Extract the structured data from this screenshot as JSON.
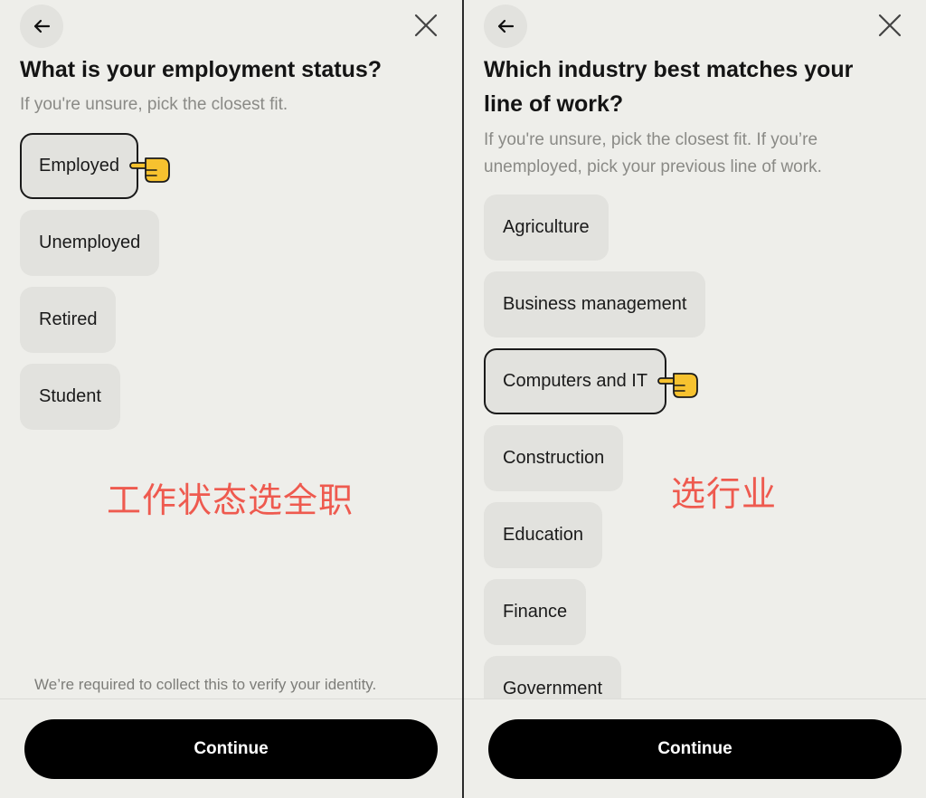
{
  "left": {
    "title": "What is your employment status?",
    "subtitle": "If you're unsure, pick the closest fit.",
    "options": [
      "Employed",
      "Unemployed",
      "Retired",
      "Student"
    ],
    "selected": "Employed",
    "annotation": "工作状态选全职",
    "note": "We’re required to collect this to verify your identity.",
    "continue_label": "Continue"
  },
  "right": {
    "title": "Which industry best matches your line of work?",
    "subtitle": "If you're unsure, pick the closest fit. If you’re unemployed, pick your previous line of work.",
    "options": [
      "Agriculture",
      "Business management",
      "Computers and IT",
      "Construction",
      "Education",
      "Finance",
      "Government"
    ],
    "selected": "Computers and IT",
    "annotation": "选行业",
    "continue_label": "Continue"
  },
  "icons": {
    "back": "arrow-left-icon",
    "close": "close-x-icon",
    "pointer": "pointing-hand-icon"
  },
  "colors": {
    "background": "#eeeeea",
    "option_bg": "#e2e2de",
    "button_bg": "#000000",
    "annotation": "#ee5a4f",
    "pointer_hand": "#f7c22f"
  }
}
